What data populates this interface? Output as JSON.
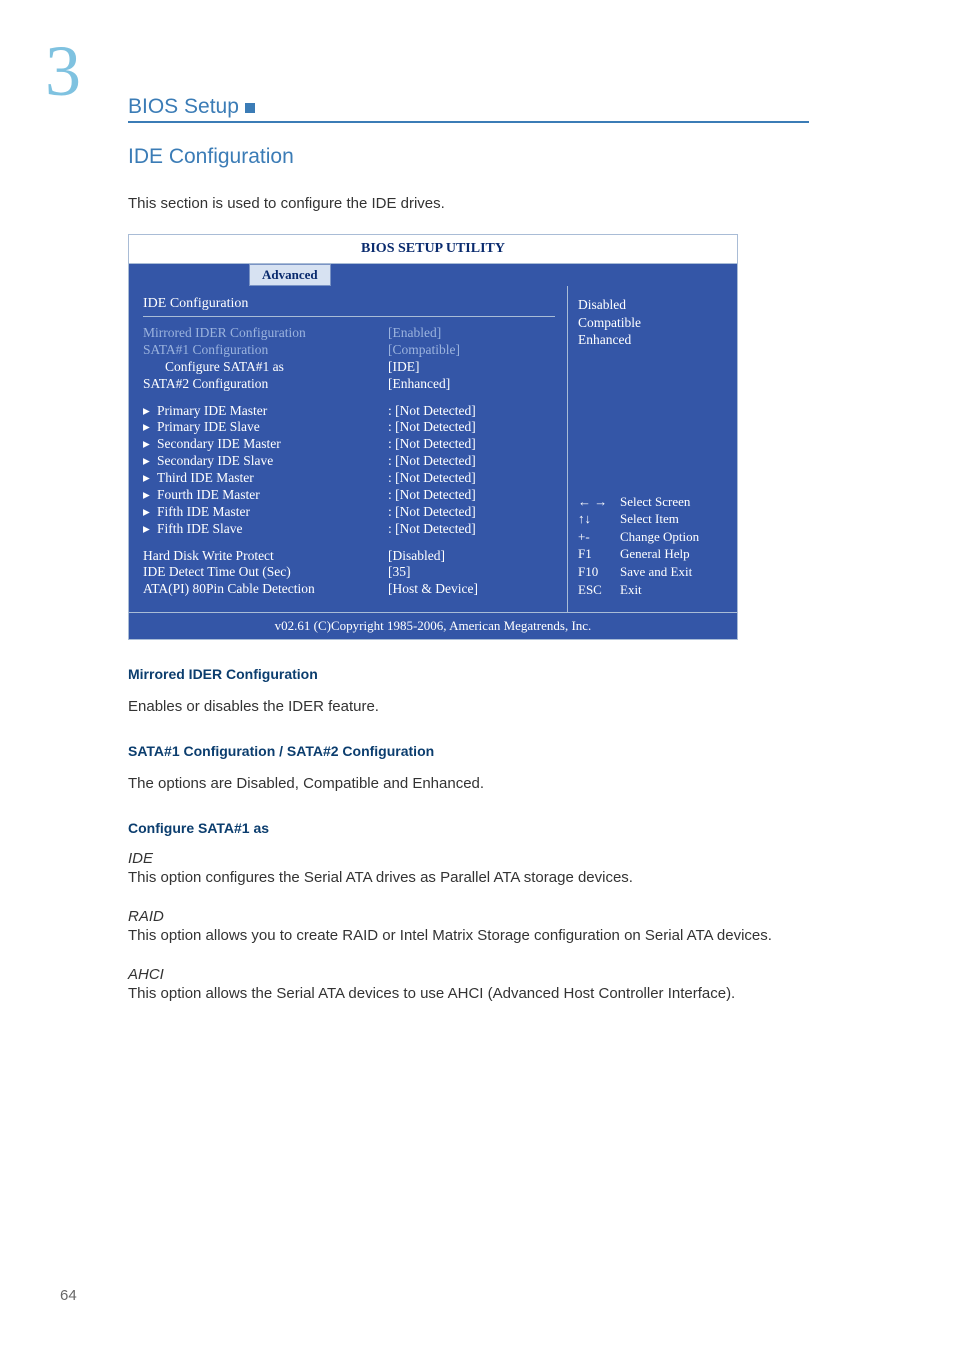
{
  "page": {
    "chapter_number": "3",
    "breadcrumb": "BIOS Setup",
    "page_number": "64"
  },
  "section": {
    "title": "IDE Configuration",
    "intro": "This section is used to configure the IDE drives."
  },
  "bios": {
    "title": "BIOS SETUP UTILITY",
    "active_tab": "Advanced",
    "panel_title": "IDE Configuration",
    "rows_group1": [
      {
        "label": "Mirrored IDER Configuration",
        "value": "[Enabled]",
        "dim": true
      },
      {
        "label": "SATA#1 Configuration",
        "value": "[Compatible]",
        "dim": true
      },
      {
        "label": "Configure SATA#1 as",
        "value": "[IDE]",
        "dim": false,
        "indent": true
      },
      {
        "label": "SATA#2 Configuration",
        "value": "[Enhanced]",
        "dim": false
      }
    ],
    "rows_group2": [
      {
        "label": "Primary IDE Master",
        "value": ": [Not Detected]"
      },
      {
        "label": "Primary IDE Slave",
        "value": ": [Not Detected]"
      },
      {
        "label": "Secondary IDE Master",
        "value": ": [Not Detected]"
      },
      {
        "label": "Secondary IDE Slave",
        "value": ": [Not Detected]"
      },
      {
        "label": "Third IDE Master",
        "value": ": [Not Detected]"
      },
      {
        "label": "Fourth IDE Master",
        "value": ": [Not Detected]"
      },
      {
        "label": "Fifth IDE Master",
        "value": ": [Not Detected]"
      },
      {
        "label": "Fifth IDE Slave",
        "value": ": [Not Detected]"
      }
    ],
    "rows_group3": [
      {
        "label": "Hard Disk Write Protect",
        "value": "[Disabled]"
      },
      {
        "label": "IDE Detect Time Out (Sec)",
        "value": "[35]"
      },
      {
        "label": "ATA(PI) 80Pin Cable Detection",
        "value": "[Host & Device]"
      }
    ],
    "help_options": [
      "Disabled",
      "Compatible",
      "Enhanced"
    ],
    "help_keys": [
      {
        "key": "← →",
        "action": "Select Screen"
      },
      {
        "key": "↑↓",
        "action": "Select Item"
      },
      {
        "key": "+-",
        "action": "Change Option"
      },
      {
        "key": "F1",
        "action": "General Help"
      },
      {
        "key": "F10",
        "action": "Save and Exit"
      },
      {
        "key": "ESC",
        "action": "Exit"
      }
    ],
    "footer": "v02.61 (C)Copyright 1985-2006, American Megatrends, Inc."
  },
  "descriptions": {
    "h1": "Mirrored IDER Configuration",
    "p1": "Enables or disables the IDER feature.",
    "h2": "SATA#1 Configuration / SATA#2 Configuration",
    "p2": "The options are Disabled, Compatible and Enhanced.",
    "h3": "Configure SATA#1 as",
    "ide_label": "IDE",
    "ide_text": "This option configures the Serial ATA drives as Parallel ATA storage devices.",
    "raid_label": "RAID",
    "raid_text": "This option allows you to create RAID or Intel Matrix Storage configuration on Serial ATA devices.",
    "ahci_label": "AHCI",
    "ahci_text": "This option allows the Serial ATA devices to use AHCI (Advanced Host Controller Interface)."
  }
}
